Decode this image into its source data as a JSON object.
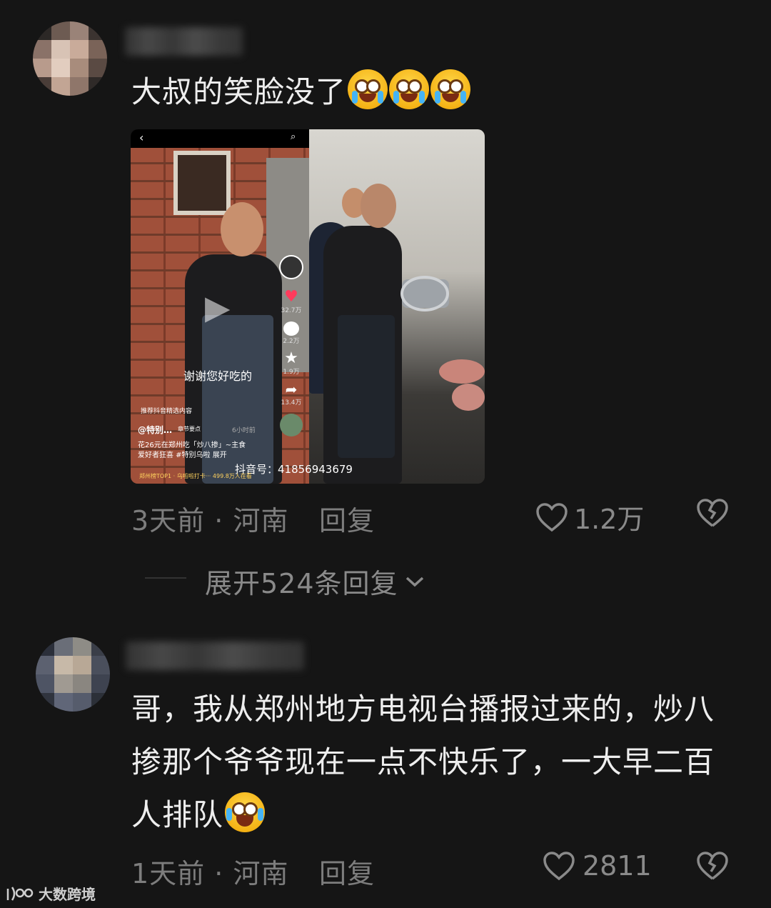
{
  "comments": [
    {
      "text": "大叔的笑脸没了",
      "emoji_count": 3,
      "emoji": "crying-face-icon",
      "time": "3天前",
      "location": "河南",
      "reply_label": "回复",
      "likes": "1.2万",
      "expand_label": "展开524条回复",
      "video": {
        "subtitle": "谢谢您好吃的",
        "likes": "32.7万",
        "comments": "2.2万",
        "favorites": "1.9万",
        "shares": "13.4万",
        "recommend": "推荐抖音精选内容",
        "author": "@特别…",
        "chapter": "章节要点",
        "posted": "6小时前",
        "caption_line1": "花26元在郑州吃「炒八掺」~主食",
        "caption_line2": "爱好者狂喜 #特别乌啦",
        "expand": "展开",
        "douyin_id": "抖音号：41856943679",
        "ranking": "郑州榜TOP1 · 乌啦啦打卡···",
        "watching": "499.8万人在看"
      }
    },
    {
      "text_line1": "哥，我从郑州地方电视台播报过来的，炒八",
      "text_line2": "掺那个爷爷现在一点不快乐了，一大早二百",
      "text_line3": "人排队",
      "emoji": "laughing-crying-face-icon",
      "time": "1天前",
      "location": "河南",
      "reply_label": "回复",
      "likes": "2811"
    }
  ],
  "watermark": "大数跨境",
  "colors": {
    "background": "#151515",
    "text": "#eeeeee",
    "meta": "#7d7d7d"
  }
}
